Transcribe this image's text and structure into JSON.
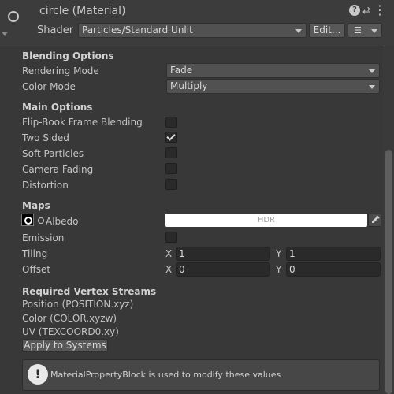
{
  "header": {
    "title": "circle (Material)",
    "shader_label": "Shader",
    "shader_value": "Particles/Standard Unlit",
    "edit_label": "Edit...",
    "icons": [
      "help-icon",
      "preset-icon",
      "menu-icon"
    ]
  },
  "blending": {
    "title": "Blending Options",
    "rendering_mode_label": "Rendering Mode",
    "rendering_mode_value": "Fade",
    "color_mode_label": "Color Mode",
    "color_mode_value": "Multiply"
  },
  "main_options": {
    "title": "Main Options",
    "items": [
      {
        "label": "Flip-Book Frame Blending",
        "checked": false
      },
      {
        "label": "Two Sided",
        "checked": true
      },
      {
        "label": "Soft Particles",
        "checked": false
      },
      {
        "label": "Camera Fading",
        "checked": false
      },
      {
        "label": "Distortion",
        "checked": false
      }
    ]
  },
  "maps": {
    "title": "Maps",
    "albedo_label": "Albedo",
    "albedo_color_text": "HDR",
    "emission_label": "Emission",
    "tiling_label": "Tiling",
    "tiling_x_axis": "X",
    "tiling_x": "1",
    "tiling_y_axis": "Y",
    "tiling_y": "1",
    "offset_label": "Offset",
    "offset_x_axis": "X",
    "offset_x": "0",
    "offset_y_axis": "Y",
    "offset_y": "0"
  },
  "vertex_streams": {
    "title": "Required Vertex Streams",
    "items": [
      "Position (POSITION.xyz)",
      "Color (COLOR.xyzw)",
      "UV (TEXCOORD0.xy)"
    ],
    "apply_label": "Apply to Systems"
  },
  "info": {
    "message": "MaterialPropertyBlock is used to modify these values"
  },
  "colors": {
    "panel_bg": "#383838",
    "header_bg": "#3c3c3c",
    "field_bg": "#2a2a2a",
    "text": "#c4c4c4"
  }
}
